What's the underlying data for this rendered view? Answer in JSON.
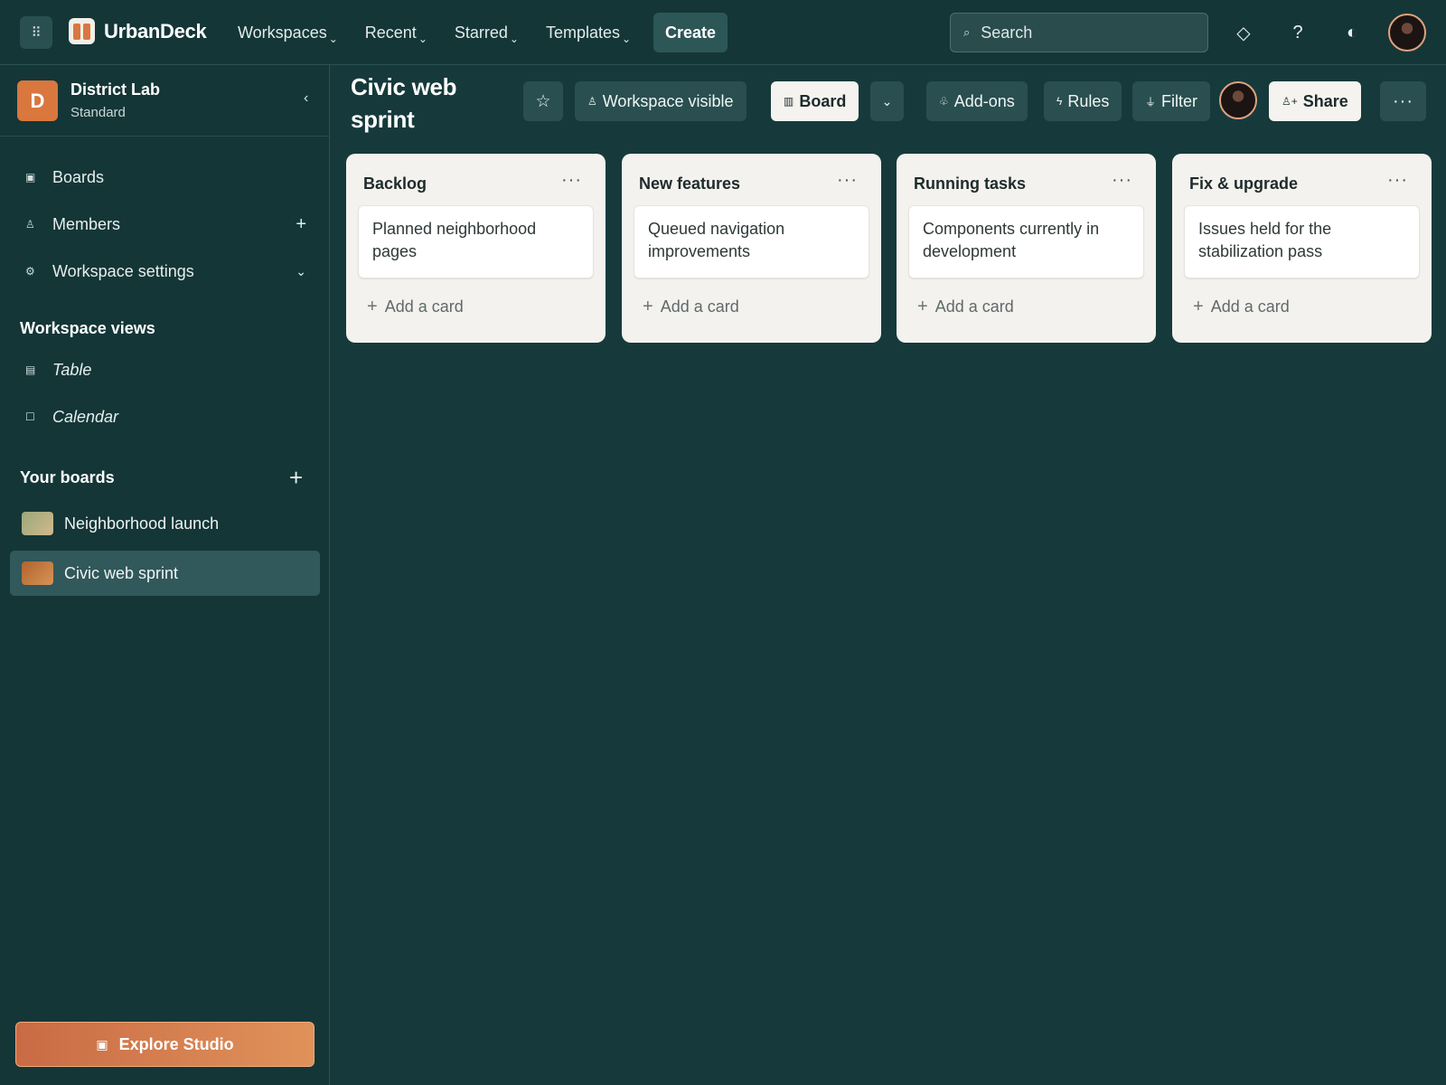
{
  "topbar": {
    "apps_icon": "grid-dots-icon",
    "logo_text": "UrbanDeck",
    "nav": [
      {
        "label": "Workspaces"
      },
      {
        "label": "Recent"
      },
      {
        "label": "Starred"
      },
      {
        "label": "Templates"
      }
    ],
    "create_label": "Create",
    "search_placeholder": "Search",
    "icons": [
      "diamond-icon",
      "help-icon",
      "theme-toggle-icon"
    ]
  },
  "sidebar": {
    "workspace_initial": "D",
    "workspace_name": "District Lab",
    "workspace_plan": "Standard",
    "items": [
      {
        "label": "Boards",
        "icon": "board-icon"
      },
      {
        "label": "Members",
        "icon": "person-icon"
      },
      {
        "label": "Workspace settings",
        "icon": "gear-icon"
      }
    ],
    "views_heading": "Workspace views",
    "views": [
      {
        "label": "Table",
        "icon": "table-icon"
      },
      {
        "label": "Calendar",
        "icon": "calendar-icon"
      }
    ],
    "boards_heading": "Your boards",
    "boards": [
      {
        "label": "Neighborhood launch",
        "thumb_from": "#9aa77a",
        "thumb_to": "#d2b98c"
      },
      {
        "label": "Civic web sprint",
        "thumb_from": "#b0642f",
        "thumb_to": "#d89356"
      }
    ],
    "explore_label": "Explore Studio"
  },
  "board": {
    "title": "Civic web sprint",
    "visibility_label": "Workspace visible",
    "view_label": "Board",
    "addons_label": "Add-ons",
    "rules_label": "Rules",
    "filter_label": "Filter",
    "share_label": "Share",
    "lists": [
      {
        "title": "Backlog",
        "card": "Planned neighborhood pages",
        "add_label": "Add a card"
      },
      {
        "title": "New features",
        "card": "Queued navigation improvements",
        "add_label": "Add a card"
      },
      {
        "title": "Running tasks",
        "card": "Components currently in development",
        "add_label": "Add a card"
      },
      {
        "title": "Fix & upgrade",
        "card": "Issues held for the stabilization pass",
        "add_label": "Add a card"
      }
    ]
  },
  "colors": {
    "background": "#163a3b",
    "accent": "#d9773f",
    "list_bg": "#f4f2ee"
  }
}
